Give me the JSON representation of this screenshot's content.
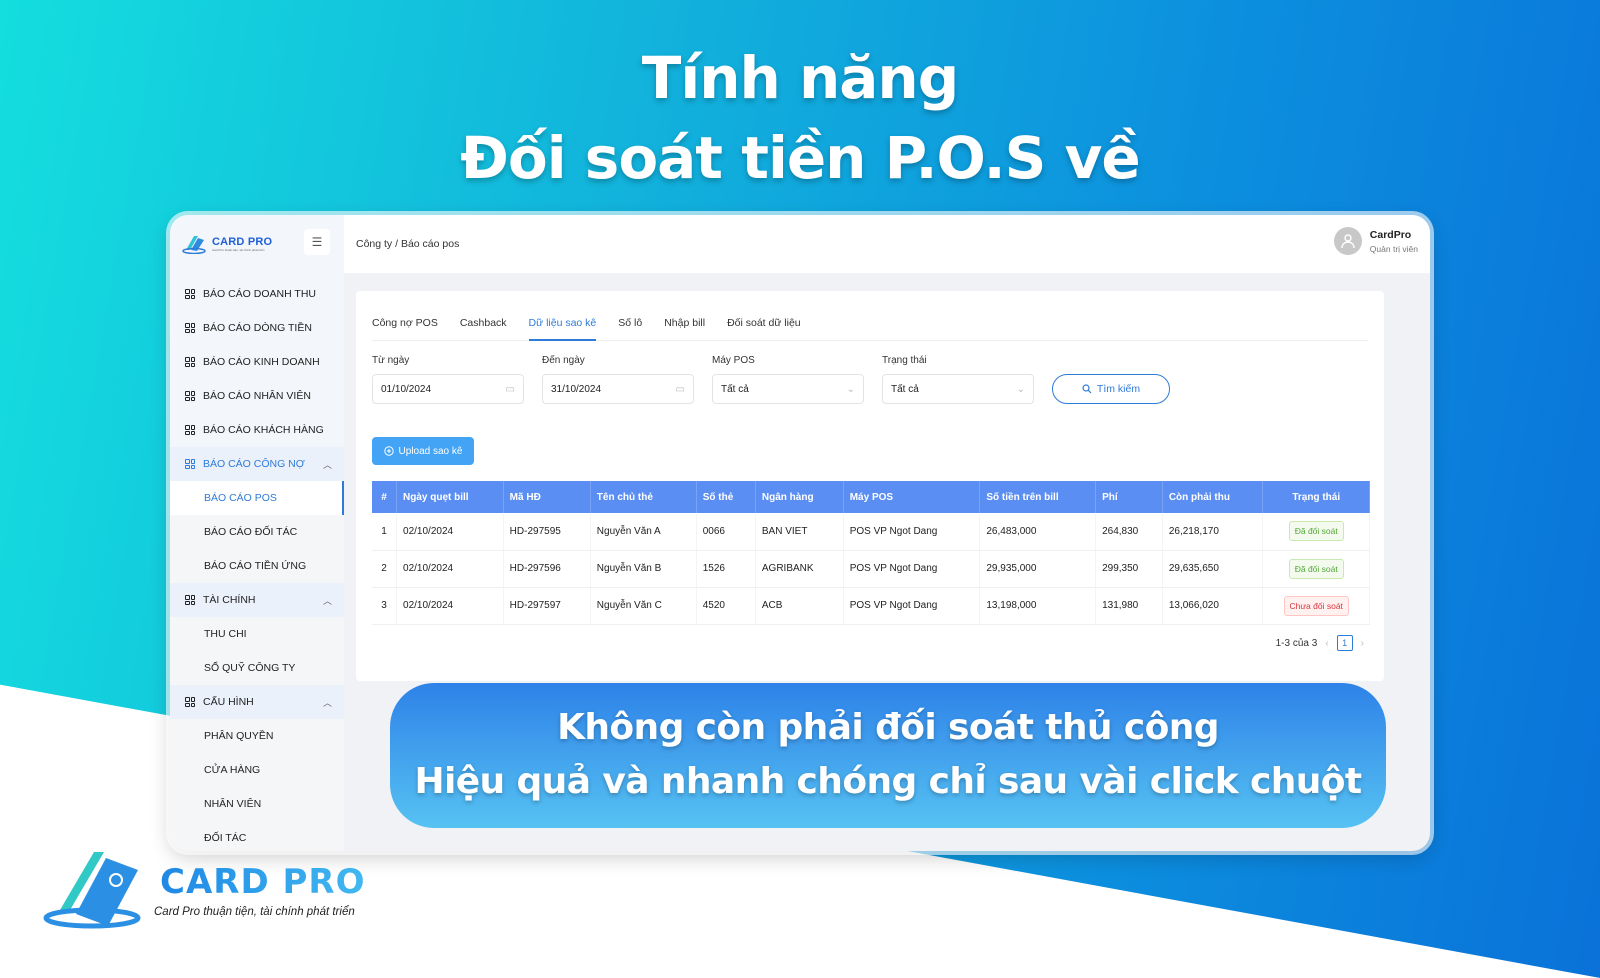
{
  "headline": {
    "line1": "Tính năng",
    "line2": "Đối soát tiền P.O.S về"
  },
  "app": {
    "logo": {
      "name": "CARD PRO",
      "tagline": "Card Pro thuận tiện, tài chính phát triển"
    },
    "breadcrumb": "Công ty / Báo cáo pos",
    "user": {
      "name": "CardPro",
      "role": "Quản trị viên"
    },
    "sidebar": {
      "items": [
        {
          "label": "BÁO CÁO DOANH THU"
        },
        {
          "label": "BÁO CÁO DÒNG TIỀN"
        },
        {
          "label": "BÁO CÁO KINH DOANH"
        },
        {
          "label": "BÁO CÁO NHÂN VIÊN"
        },
        {
          "label": "BÁO CÁO KHÁCH HÀNG"
        },
        {
          "label": "BÁO CÁO CÔNG NỢ",
          "expanded": true,
          "active": true,
          "children": [
            {
              "label": "BÁO CÁO POS",
              "active": true
            },
            {
              "label": "BÁO CÁO ĐỐI TÁC"
            },
            {
              "label": "BÁO CÁO TIỀN ỨNG"
            }
          ]
        },
        {
          "label": "TÀI CHÍNH",
          "expanded": true,
          "children": [
            {
              "label": "THU CHI"
            },
            {
              "label": "SỔ QUỸ CÔNG TY"
            }
          ]
        },
        {
          "label": "CẤU HÌNH",
          "expanded": true,
          "children": [
            {
              "label": "PHÂN QUYỀN"
            },
            {
              "label": "CỬA HÀNG"
            },
            {
              "label": "NHÂN VIÊN"
            },
            {
              "label": "ĐỐI TÁC"
            }
          ]
        }
      ]
    },
    "tabs": [
      {
        "label": "Công nợ POS"
      },
      {
        "label": "Cashback"
      },
      {
        "label": "Dữ liệu sao kê",
        "active": true
      },
      {
        "label": "Số lô"
      },
      {
        "label": "Nhập bill"
      },
      {
        "label": "Đối soát dữ liệu"
      }
    ],
    "filters": {
      "from": {
        "label": "Từ ngày",
        "value": "01/10/2024"
      },
      "to": {
        "label": "Đến ngày",
        "value": "31/10/2024"
      },
      "pos": {
        "label": "Máy POS",
        "value": "Tất cả"
      },
      "status": {
        "label": "Trạng thái",
        "value": "Tất cả"
      },
      "search_label": "Tìm kiếm"
    },
    "upload_label": "Upload sao kê",
    "table": {
      "headers": [
        "#",
        "Ngày quẹt bill",
        "Mã HĐ",
        "Tên chủ thẻ",
        "Số thẻ",
        "Ngân hàng",
        "Máy POS",
        "Số tiền trên bill",
        "Phí",
        "Còn phải thu",
        "Trạng thái"
      ],
      "rows": [
        [
          "1",
          "02/10/2024",
          "HD-297595",
          "Nguyễn Văn A",
          "0066",
          "BAN VIET",
          "POS VP Ngot Dang",
          "26,483,000",
          "264,830",
          "26,218,170",
          "Đã đối soát"
        ],
        [
          "2",
          "02/10/2024",
          "HD-297596",
          "Nguyễn Văn B",
          "1526",
          "AGRIBANK",
          "POS VP Ngot Dang",
          "29,935,000",
          "299,350",
          "29,635,650",
          "Đã đối soát"
        ],
        [
          "3",
          "02/10/2024",
          "HD-297597",
          "Nguyễn Văn C",
          "4520",
          "ACB",
          "POS VP Ngot Dang",
          "13,198,000",
          "131,980",
          "13,066,020",
          "Chưa đối soát"
        ]
      ],
      "status_kinds": [
        "ok",
        "ok",
        "no"
      ]
    },
    "pagination": {
      "summary": "1-3 của 3",
      "page": "1"
    }
  },
  "banner": {
    "line1": "Không còn phải đối soát thủ công",
    "line2": "Hiệu quả và nhanh chóng chỉ sau vài click chuột"
  },
  "brand": {
    "name": "CARD PRO",
    "tagline": "Card Pro thuận tiện, tài chính phát triển"
  },
  "colors": {
    "accent": "#2f7bd8",
    "table_header": "#5b8ef2",
    "ok": "#52a838",
    "pending": "#d9363e"
  }
}
